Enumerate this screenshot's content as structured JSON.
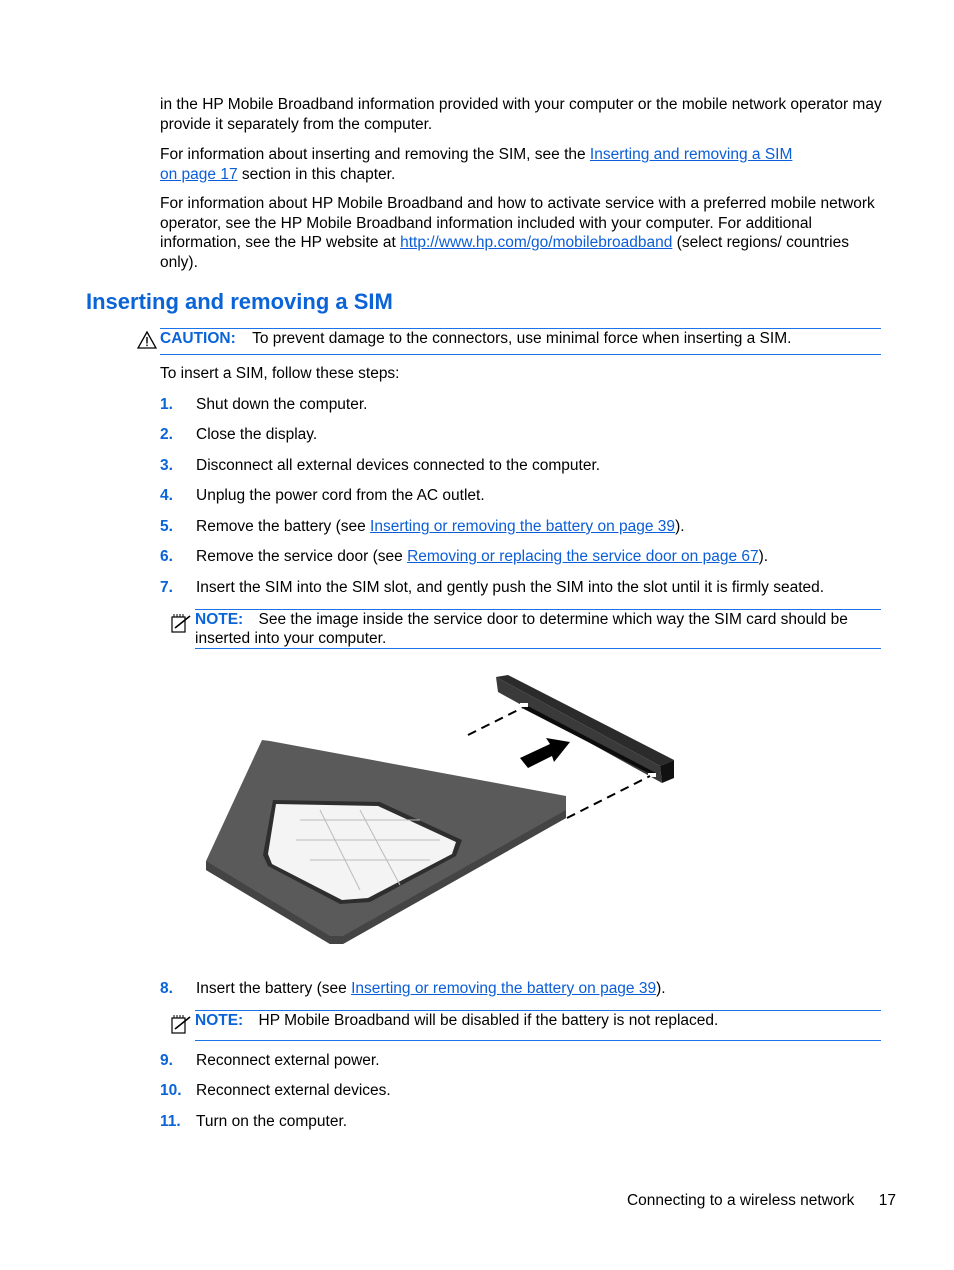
{
  "intro": {
    "p1": "in the HP Mobile Broadband information provided with your computer or the mobile network operator may provide it separately from the computer.",
    "p2_before": "For information about inserting and removing the SIM, see the ",
    "p2_link_line1": "Inserting and removing a SIM",
    "p2_link_line2": "on page 17",
    "p2_after": " section in this chapter.",
    "p3_before": "For information about HP Mobile Broadband and how to activate service with a preferred mobile network operator, see the HP Mobile Broadband information included with your computer. For additional information, see the HP website at ",
    "p3_link": "http://www.hp.com/go/mobilebroadband",
    "p3_after": " (select regions/ countries only)."
  },
  "section": {
    "title": "Inserting and removing a SIM",
    "caution_label": "CAUTION:",
    "caution_text": "To prevent damage to the connectors, use minimal force when inserting a SIM.",
    "lead": "To insert a SIM, follow these steps:"
  },
  "steps": [
    {
      "num": "1.",
      "text": "Shut down the computer."
    },
    {
      "num": "2.",
      "text": "Close the display."
    },
    {
      "num": "3.",
      "text": "Disconnect all external devices connected to the computer."
    },
    {
      "num": "4.",
      "text": "Unplug the power cord from the AC outlet."
    },
    {
      "num": "5.",
      "before": "Remove the battery (see ",
      "link": "Inserting or removing the battery on page 39",
      "after": ")."
    },
    {
      "num": "6.",
      "before": "Remove the service door (see ",
      "link": "Removing or replacing the service door on page 67",
      "after": ")."
    },
    {
      "num": "7.",
      "text": "Insert the SIM into the SIM slot, and gently push the SIM into the slot until it is firmly seated."
    },
    {
      "num": "8.",
      "before": "Insert the battery (see ",
      "link": "Inserting or removing the battery on page 39",
      "after": ")."
    },
    {
      "num": "9.",
      "text": "Reconnect external power."
    },
    {
      "num": "10.",
      "text": "Reconnect external devices."
    },
    {
      "num": "11.",
      "text": "Turn on the computer."
    }
  ],
  "notes": [
    {
      "label": "NOTE:",
      "text": "See the image inside the service door to determine which way the SIM card should be inserted into your computer."
    },
    {
      "label": "NOTE:",
      "text": "HP Mobile Broadband will be disabled if the battery is not replaced."
    }
  ],
  "figure": {
    "icon": "sim-card-insertion-illustration"
  },
  "footer": {
    "section": "Connecting to a wireless network",
    "page": "17"
  },
  "colors": {
    "accent": "#0a64d8",
    "rule": "#1a73e8"
  }
}
